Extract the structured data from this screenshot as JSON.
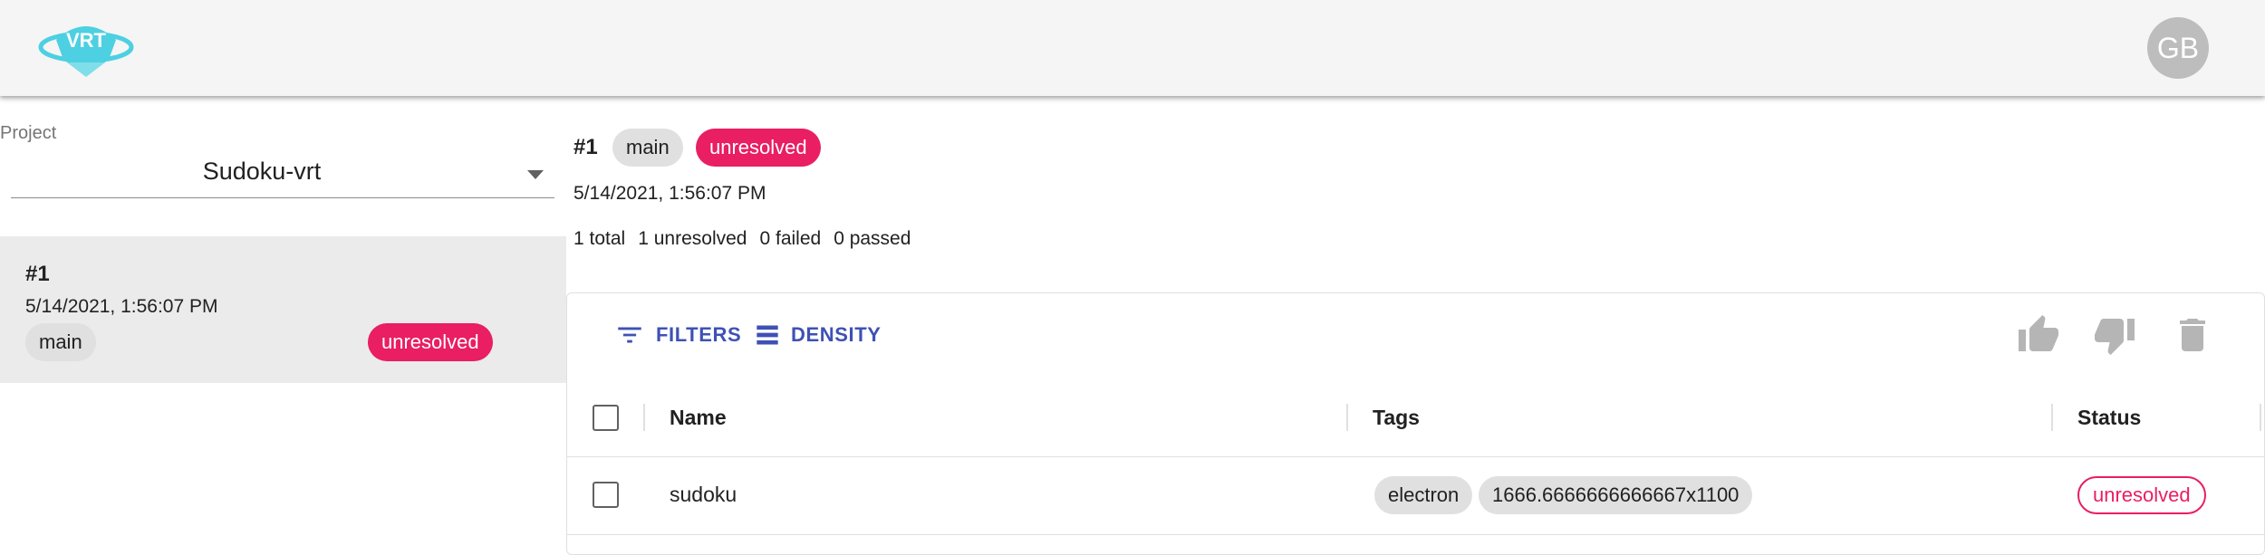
{
  "header": {
    "logo_text": "VRT",
    "avatar_initials": "GB"
  },
  "sidebar": {
    "project_label": "Project",
    "project_value": "Sudoku-vrt",
    "builds": [
      {
        "number": "#1",
        "date": "5/14/2021, 1:56:07 PM",
        "branch": "main",
        "status": "unresolved"
      }
    ]
  },
  "build": {
    "number": "#1",
    "branch": "main",
    "status": "unresolved",
    "date": "5/14/2021, 1:56:07 PM",
    "stats": {
      "total": "1 total",
      "unresolved": "1 unresolved",
      "failed": "0 failed",
      "passed": "0 passed"
    }
  },
  "grid": {
    "toolbar": {
      "filters_label": "FILTERS",
      "density_label": "DENSITY"
    },
    "columns": {
      "name": "Name",
      "tags": "Tags",
      "status": "Status"
    },
    "rows": [
      {
        "name": "sudoku",
        "tags": [
          "electron",
          "1666.6666666666667x1100"
        ],
        "status": "unresolved"
      }
    ]
  },
  "colors": {
    "accent": "#3f51b5",
    "status_unresolved": "#e91e63",
    "appbar": "#f5f5f5",
    "selected_item": "#ebebeb"
  },
  "icons": [
    "vrt-logo",
    "filter-icon",
    "density-icon",
    "thumb-up-icon",
    "thumb-down-icon",
    "delete-icon",
    "dropdown-caret-icon"
  ]
}
